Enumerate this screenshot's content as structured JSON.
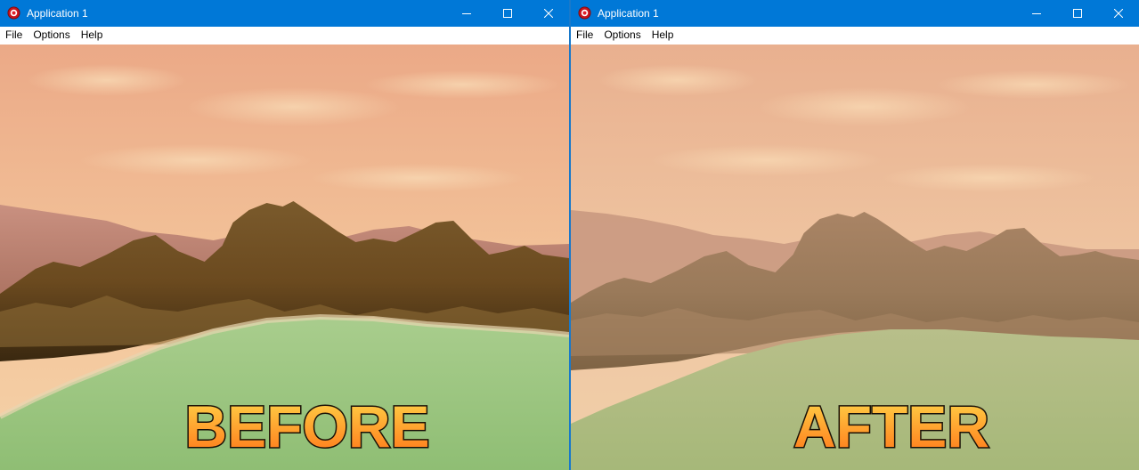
{
  "windows": [
    {
      "id": "before",
      "title": "Application 1",
      "menu": [
        "File",
        "Options",
        "Help"
      ],
      "label": "BEFORE"
    },
    {
      "id": "after",
      "title": "Application 1",
      "menu": [
        "File",
        "Options",
        "Help"
      ],
      "label": "AFTER"
    }
  ],
  "colors": {
    "titlebar": "#0078d7",
    "sky_top": "#eba987",
    "sky_bottom": "#f5cfa3",
    "ground": "#9bc381",
    "label_fill_top": "#ffd243",
    "label_fill_bottom": "#ff7a1a"
  }
}
